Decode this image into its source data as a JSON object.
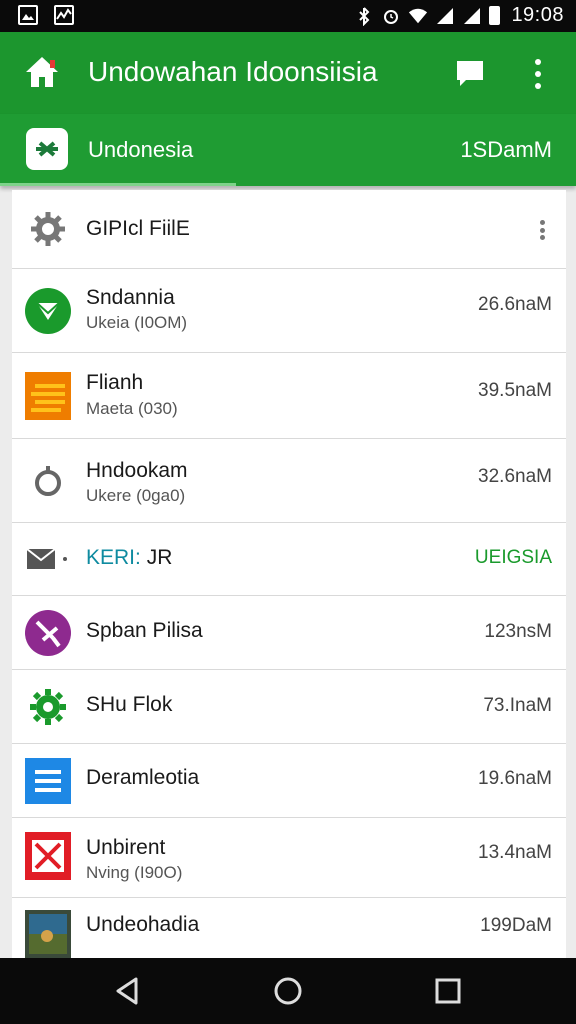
{
  "status_bar": {
    "time": "19:08"
  },
  "app_bar": {
    "title": "Undowahan Idoonsiisia"
  },
  "sub_bar": {
    "title": "Undonesia",
    "value": "1SDamM"
  },
  "list": {
    "header": {
      "title": "GIPIcl FiilE"
    },
    "items": [
      {
        "icon": "check-circle-icon",
        "title": "Sndannia",
        "subtitle": "Ukeia (I0OM)",
        "value": "26.6naM"
      },
      {
        "icon": "orange-stripes-icon",
        "title": "Flianh",
        "subtitle": "Maeta (030)",
        "value": "39.5naM"
      },
      {
        "icon": "ring-icon",
        "title": "Hndookam",
        "subtitle": "Ukere (0ga0)",
        "value": "32.6naM"
      },
      {
        "icon": "envelope-icon",
        "title_accent": "KERI:",
        "title": "JR",
        "value": "UEIGSIA"
      },
      {
        "icon": "purple-pin-icon",
        "title": "Spban Pilisa",
        "value": "123nsM"
      },
      {
        "icon": "green-gear-icon",
        "title": "SHu Flok",
        "value": "73.InaM"
      },
      {
        "icon": "menu-doc-icon",
        "title": "Deramleotia",
        "value": "19.6naM"
      },
      {
        "icon": "red-x-icon",
        "title": "Unbirent",
        "subtitle": "Nving (I90O)",
        "value": "13.4naM"
      },
      {
        "icon": "photo-thumb-icon",
        "title": "Undeohadia",
        "value": "199DaM"
      }
    ]
  },
  "colors": {
    "appbar": "#1c962e",
    "subbar": "#1f9c33",
    "accent_green": "#1a9a2c",
    "accent_teal": "#0f8ba0"
  }
}
